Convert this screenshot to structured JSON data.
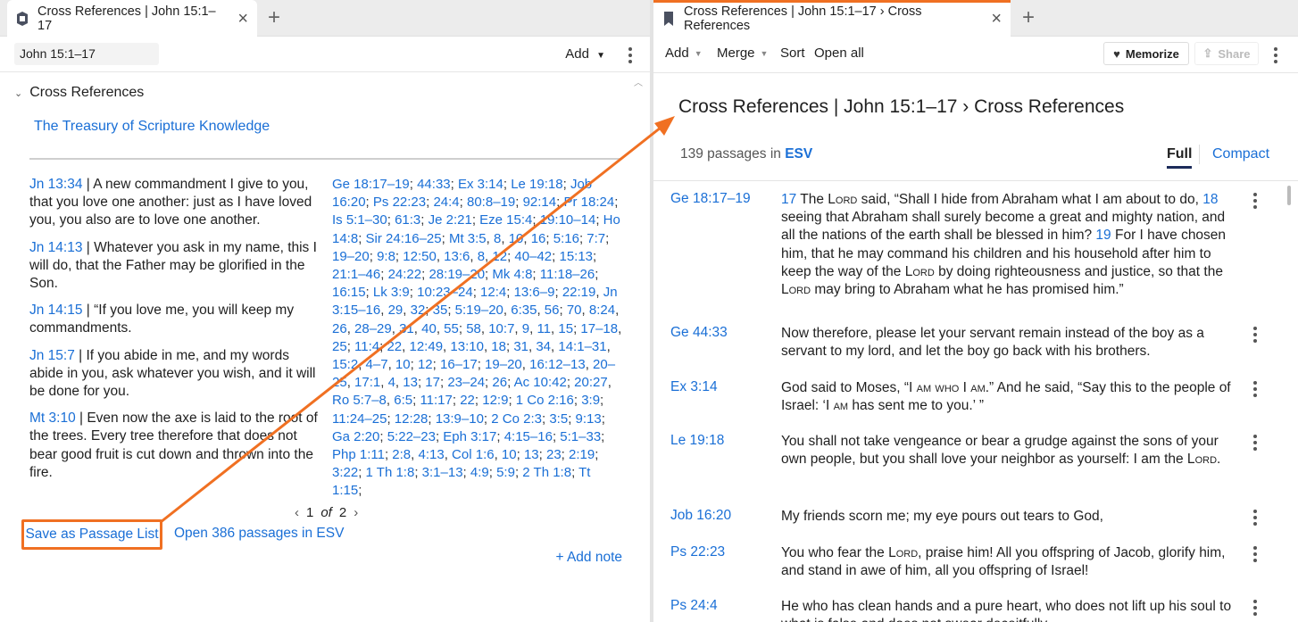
{
  "left": {
    "tab_title": "Cross References | John 15:1–17",
    "reference_value": "John 15:1–17",
    "add_label": "Add",
    "section_title": "Cross References",
    "resource_link": "The Treasury of Scripture Knowledge",
    "verses": [
      {
        "ref": "Jn 13:34",
        "text": " | A new commandment I give to you, that you love one another: just as I have loved you, you also are to love one another."
      },
      {
        "ref": "Jn 14:13",
        "text": " | Whatever you ask in my name, this I will do, that the Father may be glorified in the Son."
      },
      {
        "ref": "Jn 14:15",
        "text": " | “If you love me, you will keep my commandments."
      },
      {
        "ref": "Jn 15:7",
        "text": " | If you abide in me, and my words abide in you, ask whatever you wish, and it will be done for you."
      },
      {
        "ref": "Mt 3:10",
        "text": " | Even now the axe is laid to the root of the trees. Every tree therefore that does not bear good fruit is cut down and thrown into the fire."
      }
    ],
    "cross_refs": [
      "Ge 18:17–19",
      "44:33",
      "Ex 3:14",
      "Le 19:18",
      "Job 16:20",
      "Ps 22:23",
      "24:4",
      "80:8–19",
      "92:14",
      "Pr 18:24",
      "Is 5:1–30",
      "61:3",
      "Je 2:21",
      "Eze 15:4",
      "19:10–14",
      "Ho 14:8",
      "Sir 24:16–25",
      "Mt 3:5",
      "8",
      "10",
      "16",
      "5:16",
      "7:7",
      "19–20",
      "9:8",
      "12:50",
      "13:6",
      "8",
      "12",
      "40–42",
      "15:13",
      "21:1–46",
      "24:22",
      "28:19–20",
      "Mk 4:8",
      "11:18–26",
      "16:15",
      "Lk 3:9",
      "10:23–24",
      "12:4",
      "13:6–9",
      "22:19",
      "Jn 3:15–16",
      "29",
      "32",
      "35",
      "5:19–20",
      "6:35",
      "56",
      "70",
      "8:24",
      "26",
      "28–29",
      "31",
      "40",
      "55",
      "58",
      "10:7",
      "9",
      "11",
      "15",
      "17–18",
      "25",
      "11:4",
      "22",
      "12:49",
      "13:10",
      "18",
      "31",
      "34",
      "14:1–31",
      "15:2",
      "4–7",
      "10",
      "12",
      "16–17",
      "19–20",
      "16:12–13",
      "20–25",
      "17:1",
      "4",
      "13",
      "17",
      "23–24",
      "26",
      "Ac 10:42",
      "20:27",
      "Ro 5:7–8",
      "6:5",
      "11:17",
      "22",
      "12:9",
      "1 Co 2:16",
      "3:9",
      "11:24–25",
      "12:28",
      "13:9–10",
      "2 Co 2:3",
      "3:5",
      "9:13",
      "Ga 2:20",
      "5:22–23",
      "Eph 3:17",
      "4:15–16",
      "5:1–33",
      "Php 1:11",
      "2:8",
      "4:13",
      "Col 1:6",
      "10",
      "13",
      "23",
      "2:19",
      "3:22",
      "1 Th 1:8",
      "3:1–13",
      "4:9",
      "5:9",
      "2 Th 1:8",
      "Tt 1:15"
    ],
    "cross_ref_seps": [
      ";",
      ";",
      ";",
      ";",
      ";",
      ";",
      ";",
      ";",
      ";",
      ";",
      ";",
      ";",
      ";",
      ";",
      ";",
      ";",
      ";",
      ",",
      ",",
      ",",
      ";",
      ";",
      ";",
      ";",
      ";",
      ",",
      ",",
      ",",
      ";",
      ";",
      ";",
      ";",
      ";",
      ";",
      ";",
      ";",
      ";",
      ";",
      ";",
      ";",
      ";",
      ",",
      ",",
      ",",
      ";",
      ";",
      ",",
      ",",
      ";",
      ",",
      ",",
      ",",
      ",",
      ",",
      ",",
      ";",
      ",",
      ",",
      ",",
      ",",
      ";",
      ",",
      ";",
      ";",
      ",",
      ",",
      ",",
      ";",
      ",",
      ",",
      ",",
      ",",
      ",",
      ";",
      ";",
      ";",
      ",",
      ",",
      ",",
      ",",
      ",",
      ";",
      ";",
      ";",
      ";",
      ";",
      ",",
      ",",
      ";",
      ";",
      ";",
      ";",
      ";",
      ";",
      ";",
      ";",
      ";",
      ";",
      ";",
      ";",
      ";",
      ";",
      ";",
      ";",
      ";",
      ";",
      ",",
      ",",
      ",",
      ";",
      ";",
      ";",
      ";",
      ";",
      ";",
      ";",
      ";",
      ";",
      ";",
      ";",
      ""
    ],
    "pager": {
      "page": "1",
      "of_label": "of",
      "total": "2"
    },
    "save_button": "Save as Passage List",
    "open_link": "Open 386 passages in ESV",
    "add_note": "+ Add note"
  },
  "right": {
    "tab_title": "Cross References | John 15:1–17 › Cross References",
    "toolbar": {
      "add": "Add",
      "merge": "Merge",
      "sort": "Sort",
      "open_all": "Open all",
      "memorize": "Memorize",
      "share": "Share"
    },
    "title": "Cross References | John 15:1–17 › Cross References",
    "count_prefix": "139 passages in",
    "version": "ESV",
    "view_full": "Full",
    "view_compact": "Compact",
    "passages": [
      {
        "ref": "Ge 18:17–19",
        "html": "<span class='vnum'>17</span> The L<span class='sc'>ord</span> said, “Shall I hide from Abraham what I am about to do, <span class='vnum'>18</span> seeing that Abraham shall surely become a great and mighty nation, and all the nations of the earth shall be blessed in him? <span class='vnum'>19</span> For I have chosen him, that he may command his children and his household after him to keep the way of the L<span class='sc'>ord</span> by doing righteousness and justice, so that the L<span class='sc'>ord</span> may bring to Abraham what he has promised him.”"
      },
      {
        "ref": "Ge 44:33",
        "html": "Now therefore, please let your servant remain instead of the boy as a servant to my lord, and let the boy go back with his brothers."
      },
      {
        "ref": "Ex 3:14",
        "html": "God said to Moses, “I <span class='sc'>am who</span> I <span class='sc'>am</span>.” And he said, “Say this to the people of Israel: ‘I <span class='sc'>am</span> has sent me to you.’ ”"
      },
      {
        "ref": "Le 19:18",
        "html": "You shall not take vengeance or bear a grudge against the sons of your own people, but you shall love your neighbor as yourself: I am the L<span class='sc'>ord</span>."
      },
      {
        "ref": "Job 16:20",
        "html": "My friends scorn me; my eye pours out tears to God,"
      },
      {
        "ref": "Ps 22:23",
        "html": "You who fear the L<span class='sc'>ord</span>, praise him! All you offspring of Jacob, glorify him, and stand in awe of him, all you offspring of Israel!"
      },
      {
        "ref": "Ps 24:4",
        "html": "He who has clean hands and a pure heart, who does not lift up his soul to what is false and does not swear deceitfully."
      }
    ]
  },
  "colors": {
    "link": "#1a6fd6",
    "highlight": "#f07022",
    "underline": "#1c2b5a"
  },
  "icons": [
    "resource-tab-icon",
    "bookmark-tab-icon",
    "close-icon",
    "plus-icon",
    "chevron-down-icon",
    "kebab-menu-icon",
    "heart-icon",
    "share-icon",
    "chevron-left-icon",
    "chevron-right-icon"
  ]
}
